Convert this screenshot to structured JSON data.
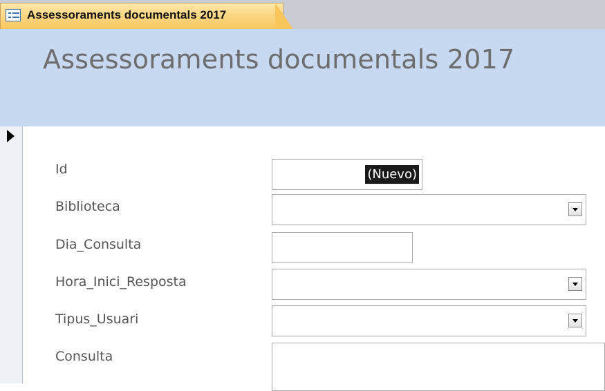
{
  "tab": {
    "title": "Assessoraments documentals 2017",
    "icon": "form-icon"
  },
  "form": {
    "title": "Assessoraments documentals 2017",
    "record_selector_icon": "current-record-arrow-icon",
    "fields": {
      "id": {
        "label": "Id",
        "value": "(Nuevo)"
      },
      "biblioteca": {
        "label": "Biblioteca",
        "value": ""
      },
      "dia_consulta": {
        "label": "Dia_Consulta",
        "value": ""
      },
      "hora_inici_resposta": {
        "label": "Hora_Inici_Resposta",
        "value": ""
      },
      "tipus_usuari": {
        "label": "Tipus_Usuari",
        "value": ""
      },
      "consulta": {
        "label": "Consulta",
        "value": ""
      }
    }
  },
  "colors": {
    "tab_active": "#f9c65c",
    "header_band": "#c6d9f1",
    "title_text": "#6d6d6d",
    "label_text": "#555555"
  }
}
